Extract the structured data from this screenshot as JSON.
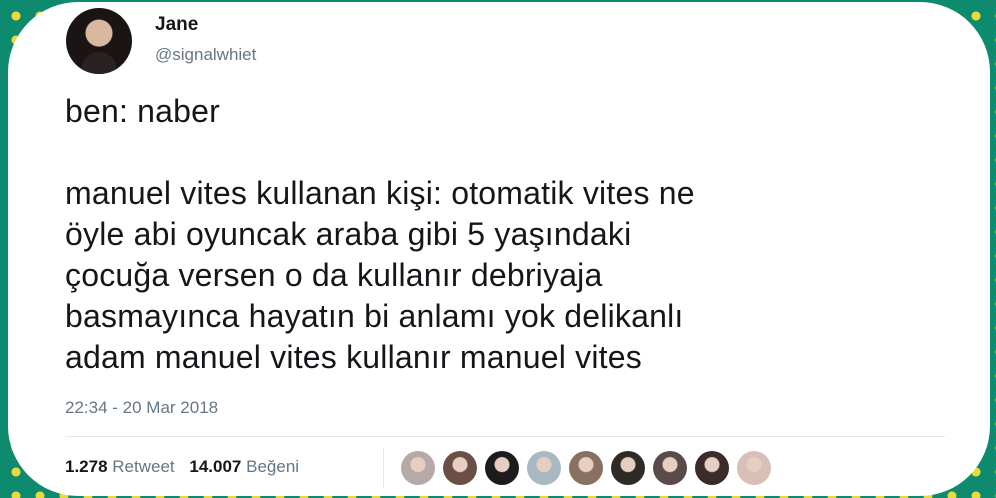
{
  "tweet": {
    "author_name": "Jane",
    "author_handle": "@signalwhiet",
    "text_line1": "ben: naber",
    "text_body": "manuel vites kullanan kişi: otomatik vites ne\nöyle abi oyuncak araba gibi 5 yaşındaki\nçocuğa versen o da kullanır debriyaja\nbasmayınca hayatın bi anlamı yok delikanlı\nadam manuel vites kullanır manuel vites",
    "timestamp": "22:34 - 20 Mar 2018",
    "retweet_count": "1.278",
    "retweet_label": "Retweet",
    "like_count": "14.007",
    "like_label": "Beğeni"
  },
  "liker_avatar_colors": [
    "#b8a9a9",
    "#6b4f45",
    "#1c1c1c",
    "#aab8c2",
    "#8a7060",
    "#2e2a26",
    "#5a4a4a",
    "#3a2c28",
    "#d8c0b8"
  ],
  "colors": {
    "background": "#0e8a6e",
    "dots": "#e9dc3a",
    "text": "#14171a",
    "secondary_text": "#657786"
  }
}
